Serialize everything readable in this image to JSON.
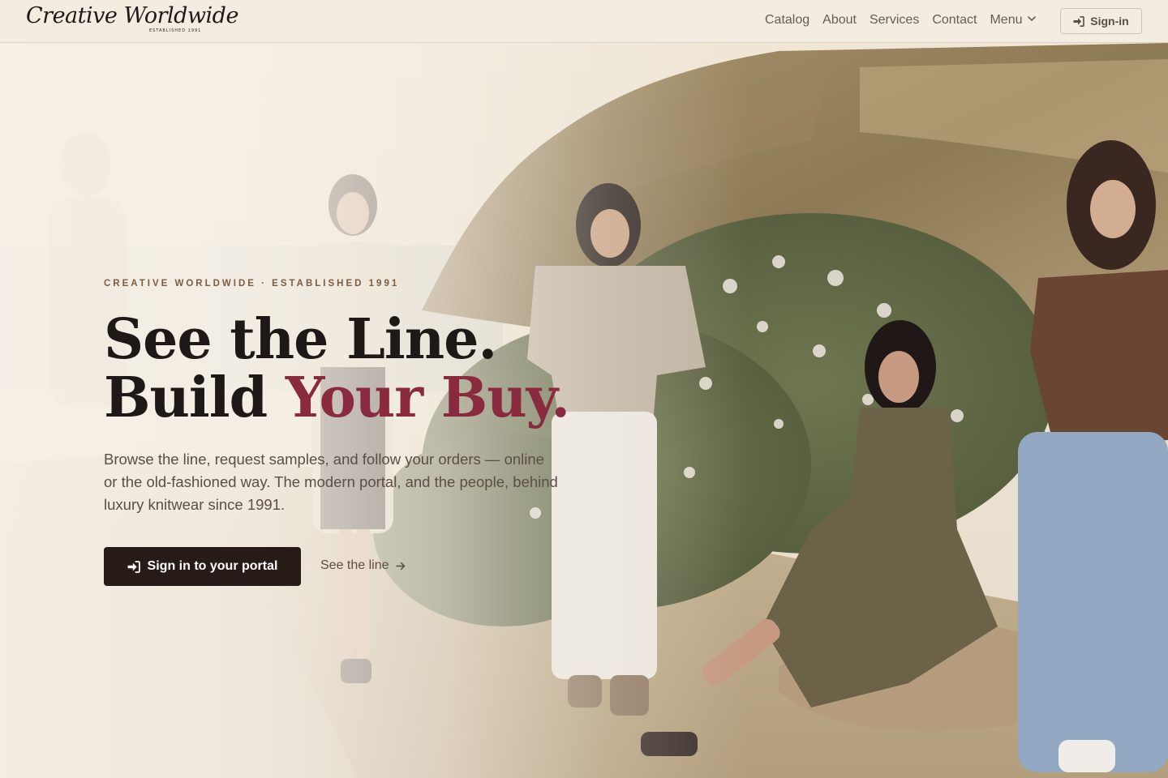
{
  "header": {
    "logo_text": "Creative Worldwide",
    "logo_tagline": "ESTABLISHED 1991",
    "nav": [
      "Catalog",
      "About",
      "Services",
      "Contact"
    ],
    "menu_label": "Menu",
    "signin_label": "Sign-in"
  },
  "hero": {
    "eyebrow": "CREATIVE WORLDWIDE · ESTABLISHED 1991",
    "headline_line1": "See the Line.",
    "headline_line2_plain": "Build ",
    "headline_line2_accent": "Your Buy.",
    "lede": "Browse the line, request samples, and follow your orders — online or the old-fashioned way. The modern portal, and the people, behind luxury knitwear since 1991.",
    "cta_primary": "Sign in to your portal",
    "cta_secondary": "See the line"
  },
  "colors": {
    "accent": "#8a2a3e",
    "primary_button": "#271b18",
    "header_bg": "#f3ece1",
    "eyebrow": "#7d5c40"
  },
  "icons": [
    "sign-in-icon",
    "chevron-down-icon",
    "arrow-right-icon"
  ]
}
